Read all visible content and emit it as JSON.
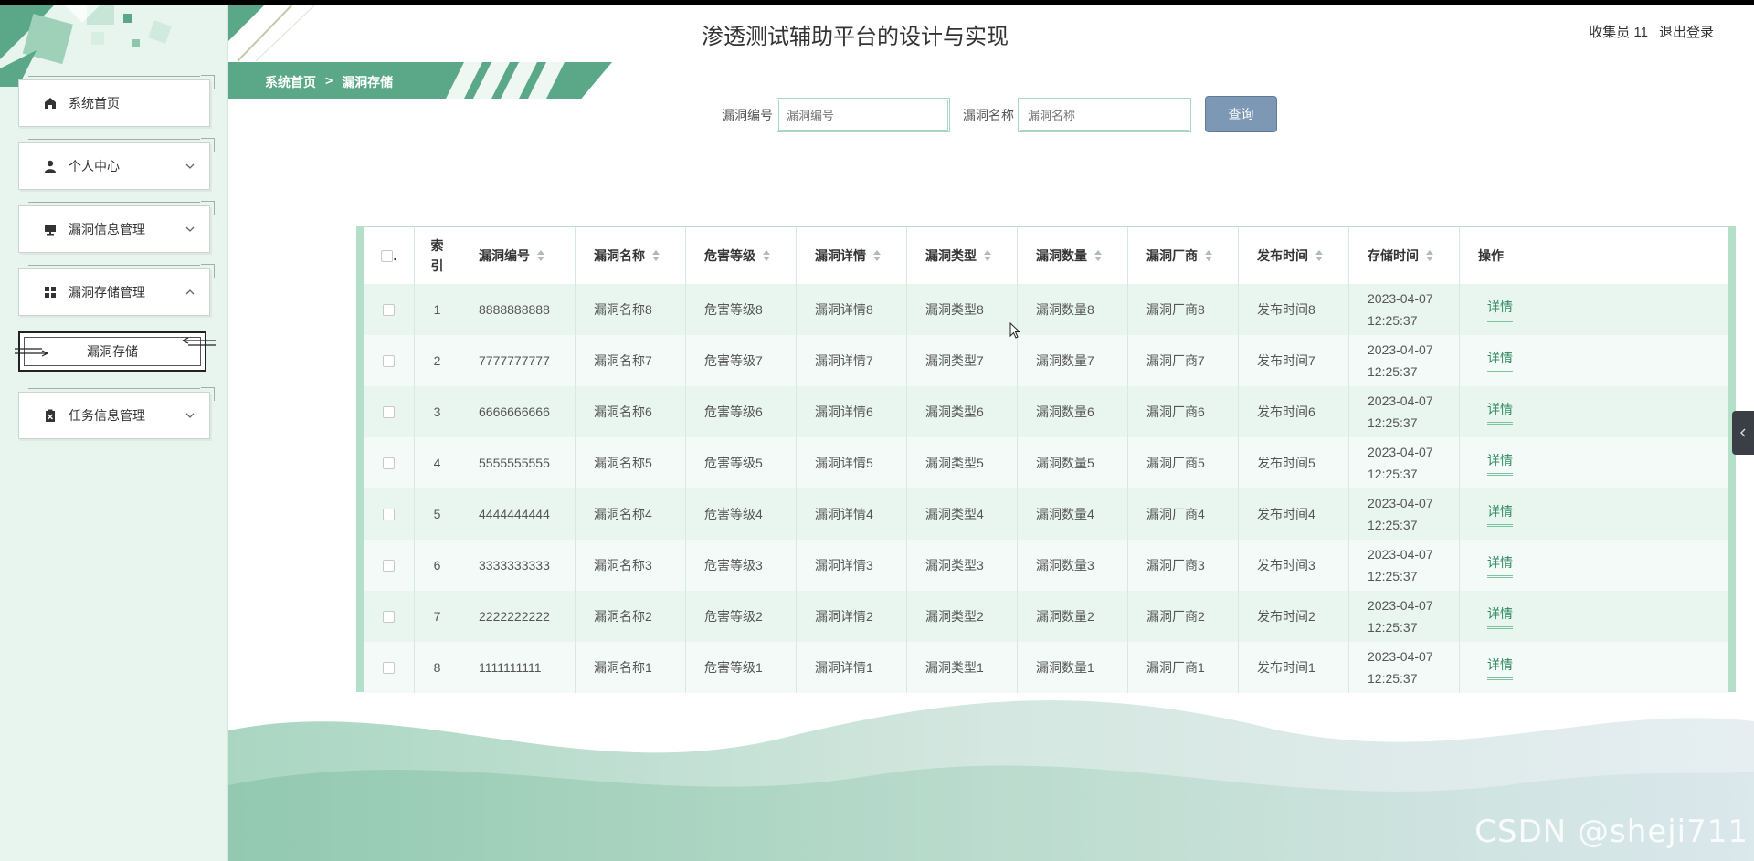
{
  "app": {
    "title": "渗透测试辅助平台的设计与实现",
    "user_label": "收集员 11",
    "logout_label": "退出登录"
  },
  "breadcrumb": {
    "home": "系统首页",
    "separator": ">",
    "current": "漏洞存储"
  },
  "sidebar": {
    "items": [
      {
        "label": "系统首页",
        "icon": "home-icon"
      },
      {
        "label": "个人中心",
        "icon": "user-icon"
      },
      {
        "label": "漏洞信息管理",
        "icon": "monitor-icon"
      },
      {
        "label": "漏洞存储管理",
        "icon": "grid-icon"
      },
      {
        "label": "漏洞存储",
        "icon": ""
      },
      {
        "label": "任务信息管理",
        "icon": "clipboard-icon"
      }
    ]
  },
  "search": {
    "field1_label": "漏洞编号",
    "field1_placeholder": "漏洞编号",
    "field2_label": "漏洞名称",
    "field2_placeholder": "漏洞名称",
    "button_label": "查询"
  },
  "table": {
    "headers": {
      "select": ".",
      "index": "索引",
      "c2": "漏洞编号",
      "c3": "漏洞名称",
      "c4": "危害等级",
      "c5": "漏洞详情",
      "c6": "漏洞类型",
      "c7": "漏洞数量",
      "c8": "漏洞厂商",
      "c9": "发布时间",
      "c10": "存储时间",
      "c11": "操作"
    },
    "action_label": "详情",
    "rows": [
      {
        "idx": "1",
        "no": "8888888888",
        "name": "漏洞名称8",
        "level": "危害等级8",
        "detail": "漏洞详情8",
        "type": "漏洞类型8",
        "count": "漏洞数量8",
        "vendor": "漏洞厂商8",
        "pub": "发布时间8",
        "date": "2023-04-07",
        "time": "12:25:37"
      },
      {
        "idx": "2",
        "no": "7777777777",
        "name": "漏洞名称7",
        "level": "危害等级7",
        "detail": "漏洞详情7",
        "type": "漏洞类型7",
        "count": "漏洞数量7",
        "vendor": "漏洞厂商7",
        "pub": "发布时间7",
        "date": "2023-04-07",
        "time": "12:25:37"
      },
      {
        "idx": "3",
        "no": "6666666666",
        "name": "漏洞名称6",
        "level": "危害等级6",
        "detail": "漏洞详情6",
        "type": "漏洞类型6",
        "count": "漏洞数量6",
        "vendor": "漏洞厂商6",
        "pub": "发布时间6",
        "date": "2023-04-07",
        "time": "12:25:37"
      },
      {
        "idx": "4",
        "no": "5555555555",
        "name": "漏洞名称5",
        "level": "危害等级5",
        "detail": "漏洞详情5",
        "type": "漏洞类型5",
        "count": "漏洞数量5",
        "vendor": "漏洞厂商5",
        "pub": "发布时间5",
        "date": "2023-04-07",
        "time": "12:25:37"
      },
      {
        "idx": "5",
        "no": "4444444444",
        "name": "漏洞名称4",
        "level": "危害等级4",
        "detail": "漏洞详情4",
        "type": "漏洞类型4",
        "count": "漏洞数量4",
        "vendor": "漏洞厂商4",
        "pub": "发布时间4",
        "date": "2023-04-07",
        "time": "12:25:37"
      },
      {
        "idx": "6",
        "no": "3333333333",
        "name": "漏洞名称3",
        "level": "危害等级3",
        "detail": "漏洞详情3",
        "type": "漏洞类型3",
        "count": "漏洞数量3",
        "vendor": "漏洞厂商3",
        "pub": "发布时间3",
        "date": "2023-04-07",
        "time": "12:25:37"
      },
      {
        "idx": "7",
        "no": "2222222222",
        "name": "漏洞名称2",
        "level": "危害等级2",
        "detail": "漏洞详情2",
        "type": "漏洞类型2",
        "count": "漏洞数量2",
        "vendor": "漏洞厂商2",
        "pub": "发布时间2",
        "date": "2023-04-07",
        "time": "12:25:37"
      },
      {
        "idx": "8",
        "no": "1111111111",
        "name": "漏洞名称1",
        "level": "危害等级1",
        "detail": "漏洞详情1",
        "type": "漏洞类型1",
        "count": "漏洞数量1",
        "vendor": "漏洞厂商1",
        "pub": "发布时间1",
        "date": "2023-04-07",
        "time": "12:25:37"
      }
    ]
  },
  "watermark": "CSDN @sheji711",
  "colors": {
    "accent": "#5aa887",
    "sidebar_bg": "#e8f4ee",
    "row_odd": "#e9f6f0",
    "query_button": "#7d98b5"
  }
}
